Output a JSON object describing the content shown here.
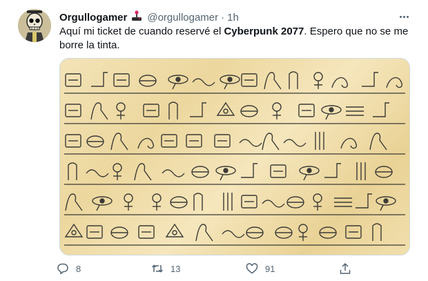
{
  "tweet": {
    "author_name": "Orgullogamer",
    "author_emoji": "joystick-icon",
    "handle": "@orgullogamer",
    "separator": "·",
    "time": "1h",
    "text_before": "Aquí mi ticket de cuando reservé el ",
    "text_bold": "Cyberpunk 2077",
    "text_after": ". Espero que no se me borre la tinta.",
    "media_description_icon": "egyptian-hieroglyphs-papyrus"
  },
  "actions": {
    "reply_count": "8",
    "retweet_count": "13",
    "like_count": "91"
  },
  "colors": {
    "text": "#0f1419",
    "muted": "#536471",
    "papyrus": "#ecd79e",
    "ink": "#3b3a36"
  }
}
